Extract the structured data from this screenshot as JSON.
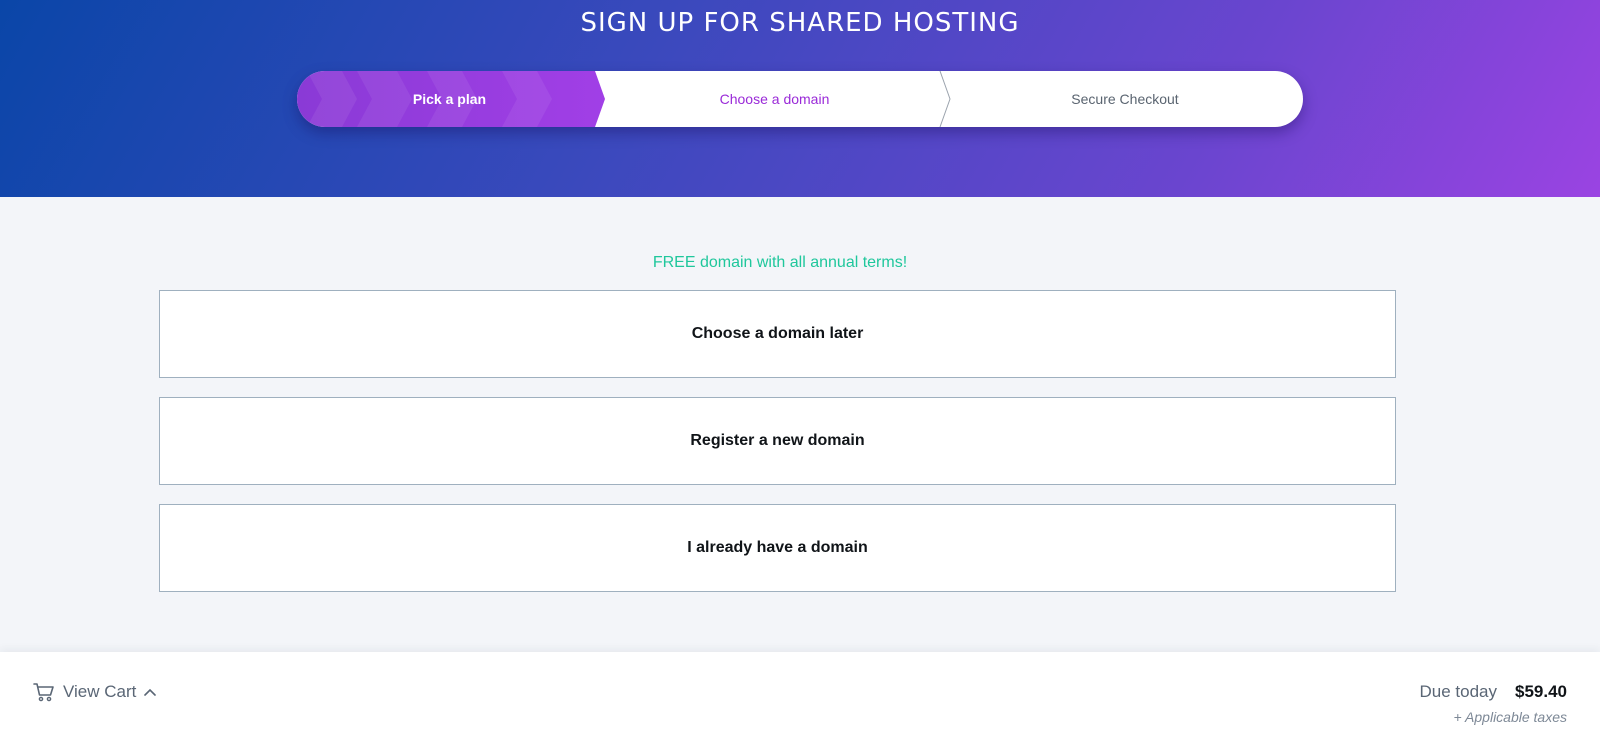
{
  "header": {
    "title": "SIGN UP FOR SHARED HOSTING"
  },
  "stepper": {
    "steps": [
      {
        "label": "Pick a plan",
        "state": "completed"
      },
      {
        "label": "Choose a domain",
        "state": "current"
      },
      {
        "label": "Secure Checkout",
        "state": "upcoming"
      }
    ]
  },
  "main": {
    "promo": "FREE domain with all annual terms!",
    "options": [
      {
        "label": "Choose a domain later"
      },
      {
        "label": "Register a new domain"
      },
      {
        "label": "I already have a domain"
      }
    ]
  },
  "footer": {
    "cart_label": "View Cart",
    "due_label": "Due today",
    "due_amount": "$59.40",
    "taxes_note": "+ Applicable taxes"
  },
  "colors": {
    "accent_purple": "#9a2ad8",
    "promo_green": "#1fc79c",
    "header_gradient_start": "#0a46a8",
    "header_gradient_end": "#9a44e2"
  },
  "icons": {
    "cart": "cart-icon",
    "chevron": "chevron-up-icon"
  }
}
